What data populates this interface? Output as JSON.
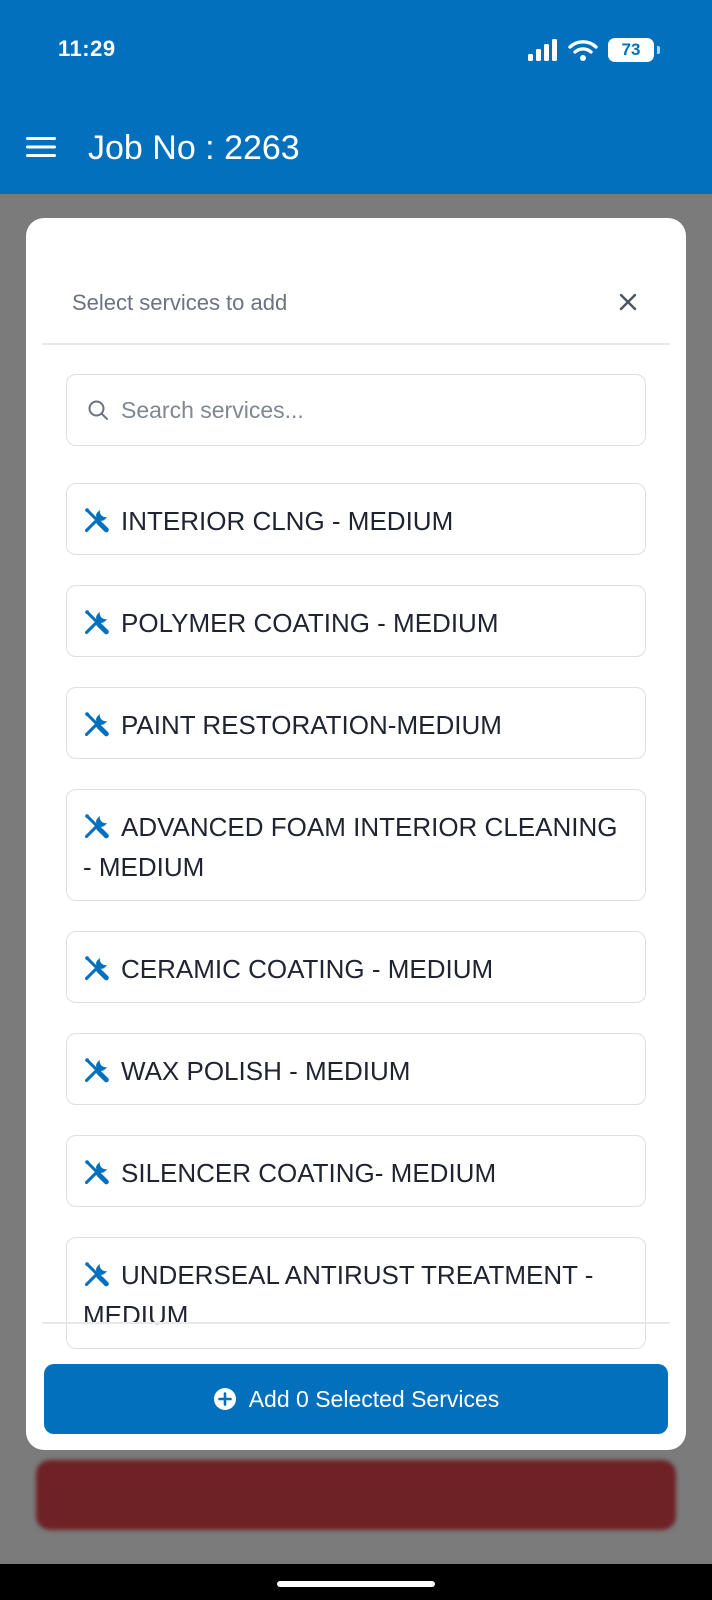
{
  "status": {
    "time": "11:29",
    "battery": "73"
  },
  "appbar": {
    "title": "Job No : 2263"
  },
  "modal": {
    "title": "Select services to add",
    "search_placeholder": "Search services...",
    "services": [
      {
        "label": "INTERIOR CLNG - MEDIUM"
      },
      {
        "label": "POLYMER COATING - MEDIUM"
      },
      {
        "label": "PAINT RESTORATION-MEDIUM"
      },
      {
        "label": "ADVANCED FOAM INTERIOR CLEANING - MEDIUM"
      },
      {
        "label": "CERAMIC COATING - MEDIUM"
      },
      {
        "label": "WAX POLISH - MEDIUM"
      },
      {
        "label": "SILENCER COATING- MEDIUM"
      },
      {
        "label": "UNDERSEAL ANTIRUST TREATMENT - MEDIUM"
      }
    ],
    "add_button_label": "Add 0 Selected Services",
    "service_icon": "tools-icon"
  },
  "colors": {
    "brand": "#0270bd",
    "danger_background": "#6e2226"
  }
}
